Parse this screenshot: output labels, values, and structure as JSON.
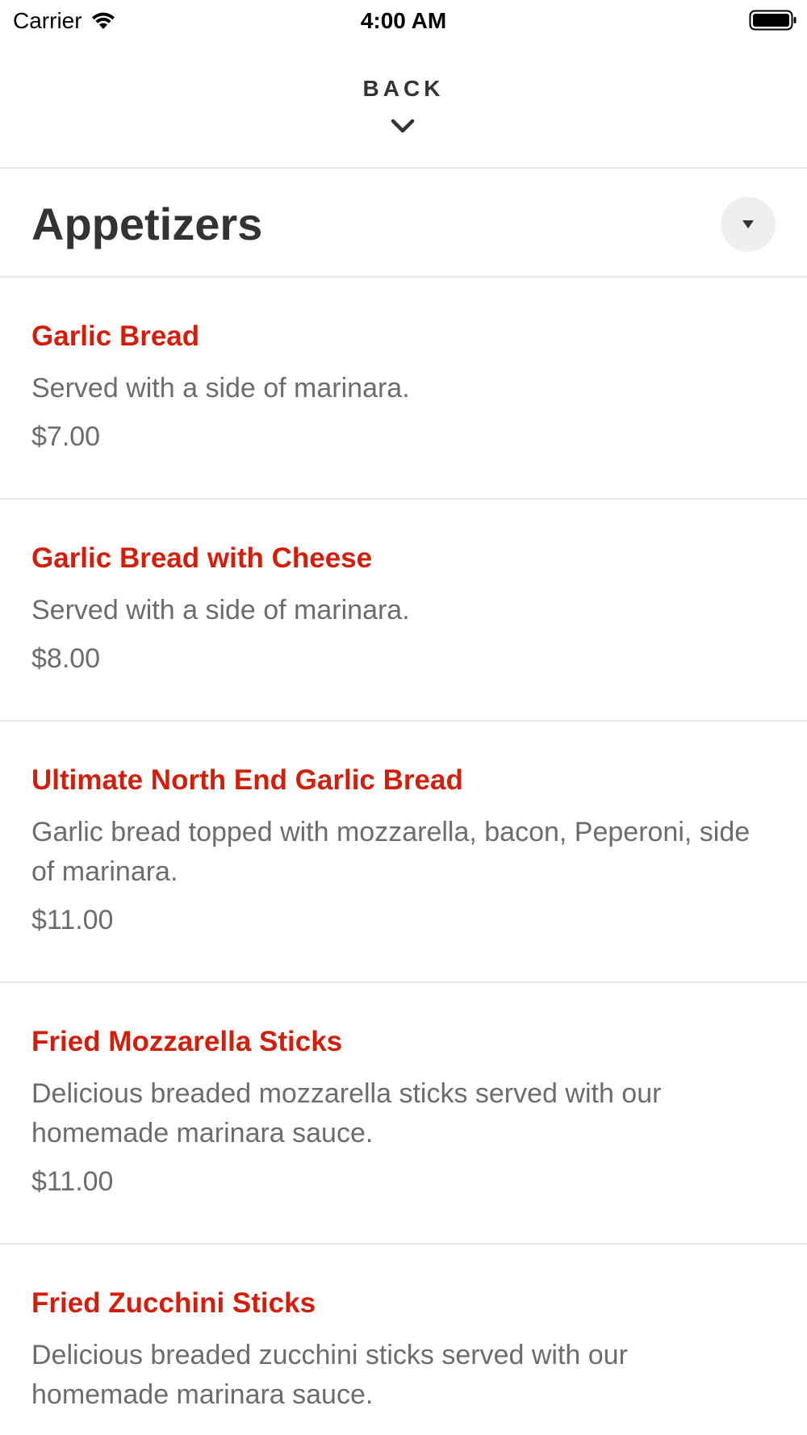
{
  "status_bar": {
    "carrier": "Carrier",
    "time": "4:00 AM"
  },
  "header": {
    "back_label": "BACK"
  },
  "category": {
    "title": "Appetizers"
  },
  "colors": {
    "item_name": "#d41e0c",
    "text_secondary": "#6c6c6c",
    "divider": "#e7e7e7"
  },
  "menu": {
    "items": [
      {
        "name": "Garlic Bread",
        "description": "Served with a side of marinara.",
        "price": "$7.00"
      },
      {
        "name": "Garlic Bread with Cheese",
        "description": "Served with a side of marinara.",
        "price": "$8.00"
      },
      {
        "name": "Ultimate North End Garlic Bread",
        "description": "Garlic bread topped with mozzarella, bacon, Peperoni, side of marinara.",
        "price": "$11.00"
      },
      {
        "name": "Fried Mozzarella Sticks",
        "description": "Delicious breaded mozzarella sticks served with our homemade marinara sauce.",
        "price": "$11.00"
      },
      {
        "name": "Fried Zucchini Sticks",
        "description": "Delicious breaded zucchini sticks served with our homemade marinara sauce.",
        "price": ""
      }
    ]
  }
}
